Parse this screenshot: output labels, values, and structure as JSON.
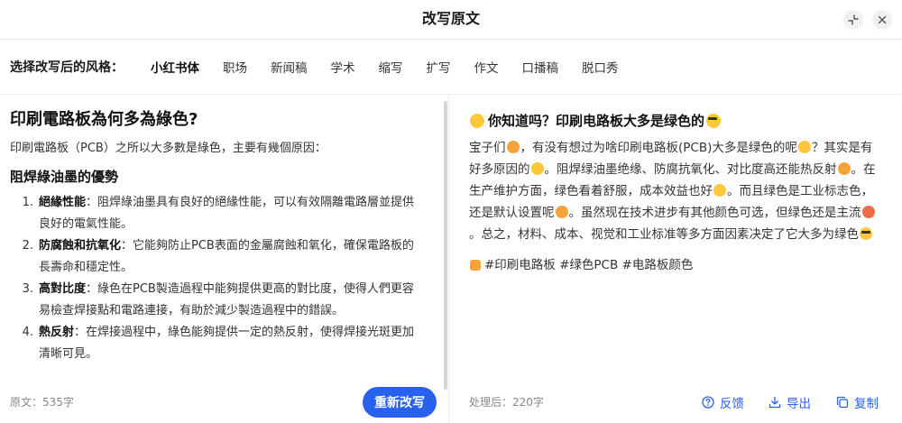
{
  "header": {
    "title": "改写原文"
  },
  "stylebar": {
    "label": "选择改写后的风格：",
    "tabs": [
      "小红书体",
      "职场",
      "新闻稿",
      "学术",
      "缩写",
      "扩写",
      "作文",
      "口播稿",
      "脱口秀"
    ],
    "active_index": 0
  },
  "original": {
    "title": "印刷電路板為何多為綠色?",
    "intro": "印刷電路板（PCB）之所以大多數是綠色，主要有幾個原因：",
    "subtitle": "阻焊綠油墨的優勢",
    "items": [
      {
        "num": "1.",
        "term": "絕緣性能",
        "text": "：阻焊綠油墨具有良好的絕緣性能，可以有效隔離電路層並提供良好的電氣性能。"
      },
      {
        "num": "2.",
        "term": "防腐蝕和抗氧化",
        "text": "：它能夠防止PCB表面的金屬腐蝕和氧化，確保電路板的長壽命和穩定性。"
      },
      {
        "num": "3.",
        "term": "高對比度",
        "text": "：綠色在PCB製造過程中能夠提供更高的對比度，使得人們更容易檢查焊接點和電路連接，有助於減少製造過程中的錯誤。"
      },
      {
        "num": "4.",
        "term": "熱反射",
        "text": "：在焊接過程中，綠色能夠提供一定的熱反射，使得焊接光斑更加清晰可見。"
      }
    ],
    "count_label": "原文：535字",
    "regenerate_label": "重新改写"
  },
  "result": {
    "title": "你知道吗？印刷电路板大多是绿色的",
    "body_parts": [
      "宝子们",
      "，有没有想过为啥印刷电路板(PCB)大多是绿色的呢",
      "？其实是有好多原因的",
      "。阻焊绿油墨绝缘、防腐抗氧化、对比度高还能热反射",
      "。在生产维护方面，绿色看着舒服，成本效益也好",
      "。而且绿色是工业标志色，还是默认设置呢",
      "。虽然现在技术进步有其他颜色可选，但绿色还是主流",
      "。总之，材料、成本、视觉和工业标准等多方面因素决定了它大多为绿色"
    ],
    "tags": "#印刷电路板 #绿色PCB #电路板颜色",
    "count_label": "处理后：220字",
    "actions": {
      "feedback": "反馈",
      "export": "导出",
      "copy": "复制"
    }
  },
  "colors": {
    "accent": "#2761ee",
    "divider": "#ececec",
    "text": "#333333"
  },
  "icons": [
    "collapse-icon",
    "close-icon",
    "thinking-face-emoji",
    "sunglasses-emoji",
    "question-icon",
    "download-icon",
    "copy-icon"
  ]
}
